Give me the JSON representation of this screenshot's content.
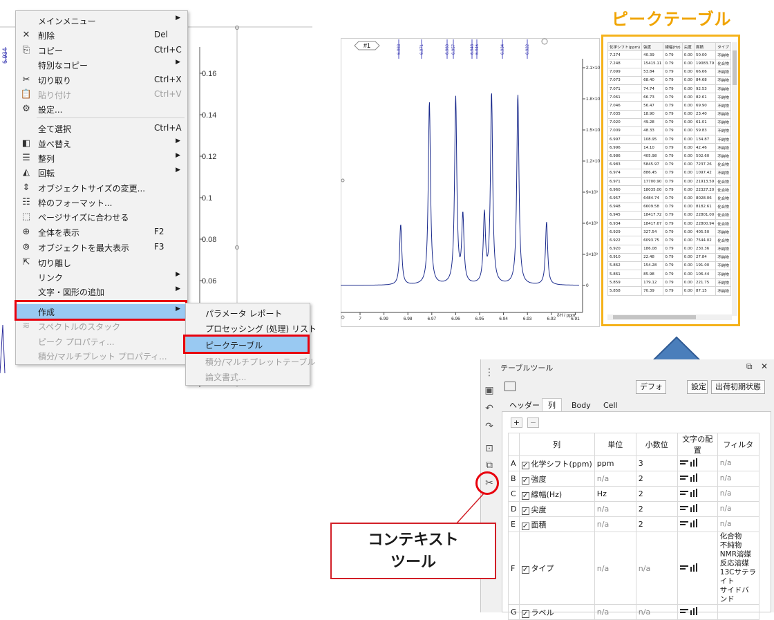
{
  "left_chart": {
    "ppm_label": "6.934",
    "y_ticks": [
      "0.16",
      "0.14",
      "0.12",
      "0.1",
      "0.08",
      "0.06"
    ]
  },
  "context_menu": {
    "items": [
      {
        "label": "メインメニュー",
        "icon": "",
        "shortcut": "",
        "arrow": true,
        "disabled": false
      },
      {
        "label": "削除",
        "icon": "close-icon",
        "shortcut": "Del",
        "arrow": false,
        "disabled": false
      },
      {
        "label": "コピー",
        "icon": "copy-icon",
        "shortcut": "Ctrl+C",
        "arrow": false,
        "disabled": false
      },
      {
        "label": "特別なコピー",
        "icon": "",
        "shortcut": "",
        "arrow": true,
        "disabled": false
      },
      {
        "label": "切り取り",
        "icon": "scissors-icon",
        "shortcut": "Ctrl+X",
        "arrow": false,
        "disabled": false
      },
      {
        "label": "貼り付け",
        "icon": "paste-icon",
        "shortcut": "Ctrl+V",
        "arrow": false,
        "disabled": true
      },
      {
        "label": "設定...",
        "icon": "gear-icon",
        "shortcut": "",
        "arrow": false,
        "disabled": false
      },
      {
        "label": "全て選択",
        "icon": "",
        "shortcut": "Ctrl+A",
        "arrow": false,
        "disabled": false
      },
      {
        "label": "並べ替え",
        "icon": "arrange-icon",
        "shortcut": "",
        "arrow": true,
        "disabled": false
      },
      {
        "label": "整列",
        "icon": "align-icon",
        "shortcut": "",
        "arrow": true,
        "disabled": false
      },
      {
        "label": "回転",
        "icon": "rotate-icon",
        "shortcut": "",
        "arrow": true,
        "disabled": false
      },
      {
        "label": "オブジェクトサイズの変更...",
        "icon": "resize-icon",
        "shortcut": "",
        "arrow": false,
        "disabled": false
      },
      {
        "label": "枠のフォーマット...",
        "icon": "format-icon",
        "shortcut": "",
        "arrow": false,
        "disabled": false
      },
      {
        "label": "ページサイズに合わせる",
        "icon": "fit-page-icon",
        "shortcut": "",
        "arrow": false,
        "disabled": false
      },
      {
        "label": "全体を表示",
        "icon": "zoom-all-icon",
        "shortcut": "F2",
        "arrow": false,
        "disabled": false
      },
      {
        "label": "オブジェクトを最大表示",
        "icon": "zoom-object-icon",
        "shortcut": "F3",
        "arrow": false,
        "disabled": false
      },
      {
        "label": "切り離し",
        "icon": "detach-icon",
        "shortcut": "",
        "arrow": false,
        "disabled": false
      },
      {
        "label": "リンク",
        "icon": "",
        "shortcut": "",
        "arrow": true,
        "disabled": false
      },
      {
        "label": "文字・図形の追加",
        "icon": "",
        "shortcut": "",
        "arrow": true,
        "disabled": false
      },
      {
        "label": "作成",
        "icon": "",
        "shortcut": "",
        "arrow": true,
        "disabled": false
      },
      {
        "label": "スペクトルのスタック",
        "icon": "stack-icon",
        "shortcut": "",
        "arrow": false,
        "disabled": true
      },
      {
        "label": "ピーク プロパティ...",
        "icon": "",
        "shortcut": "",
        "arrow": false,
        "disabled": true
      },
      {
        "label": "積分/マルチプレット プロパティ...",
        "icon": "",
        "shortcut": "",
        "arrow": false,
        "disabled": true
      }
    ]
  },
  "submenu": {
    "items": [
      {
        "label": "パラメータ レポート",
        "disabled": false
      },
      {
        "label": "プロセッシング (処理) リスト",
        "disabled": false
      },
      {
        "label": "ピークテーブル",
        "disabled": false
      },
      {
        "label": "積分/マルチプレットテーブル",
        "disabled": true
      },
      {
        "label": "論文書式...",
        "disabled": true
      }
    ]
  },
  "spectrum": {
    "badge": "#1",
    "peak_labels": [
      "6.983",
      "6.971",
      "6.960",
      "6.957",
      "6.948",
      "6.945",
      "6.934",
      "6.922"
    ],
    "x_ticks": [
      "7",
      "6.99",
      "6.98",
      "6.97",
      "6.96",
      "6.95",
      "6.94",
      "6.93",
      "6.92",
      "6.91"
    ],
    "x_unit": "δH / ppm",
    "y_ticks": [
      "2.1×10⁴",
      "1.8×10⁴",
      "1.5×10⁴",
      "1.2×10⁴",
      "9×10³",
      "6×10³",
      "3×10³",
      "0"
    ]
  },
  "peak_table": {
    "title": "ピークテーブル",
    "headers": [
      "化学シフト(ppm)",
      "強度",
      "線幅(Hz)",
      "尖度",
      "面積",
      "タイプ"
    ],
    "rows": [
      [
        "7.274",
        "40.39",
        "0.79",
        "0.00",
        "50.00",
        "不純物"
      ],
      [
        "7.248",
        "15415.11",
        "0.79",
        "0.00",
        "19083.79",
        "化合物"
      ],
      [
        "7.099",
        "53.84",
        "0.79",
        "0.00",
        "66.66",
        "不純物"
      ],
      [
        "7.073",
        "68.40",
        "0.79",
        "0.00",
        "84.68",
        "不純物"
      ],
      [
        "7.071",
        "74.74",
        "0.79",
        "0.00",
        "92.53",
        "不純物"
      ],
      [
        "7.061",
        "66.73",
        "0.79",
        "0.00",
        "82.61",
        "不純物"
      ],
      [
        "7.046",
        "56.47",
        "0.79",
        "0.00",
        "69.90",
        "不純物"
      ],
      [
        "7.035",
        "18.90",
        "0.79",
        "0.00",
        "23.40",
        "不純物"
      ],
      [
        "7.020",
        "49.28",
        "0.79",
        "0.00",
        "61.01",
        "不純物"
      ],
      [
        "7.009",
        "48.33",
        "0.79",
        "0.00",
        "59.83",
        "不純物"
      ],
      [
        "6.997",
        "108.95",
        "0.79",
        "0.00",
        "134.87",
        "不純物"
      ],
      [
        "6.996",
        "14.10",
        "0.79",
        "0.00",
        "42.46",
        "不純物"
      ],
      [
        "6.986",
        "405.98",
        "0.79",
        "0.00",
        "502.60",
        "不純物"
      ],
      [
        "6.983",
        "5845.97",
        "0.79",
        "0.00",
        "7237.26",
        "化合物"
      ],
      [
        "6.974",
        "886.45",
        "0.79",
        "0.00",
        "1097.42",
        "不純物"
      ],
      [
        "6.971",
        "17700.90",
        "0.79",
        "0.00",
        "21913.59",
        "化合物"
      ],
      [
        "6.960",
        "18035.00",
        "0.79",
        "0.00",
        "22327.20",
        "化合物"
      ],
      [
        "6.957",
        "6484.74",
        "0.79",
        "0.00",
        "8028.06",
        "化合物"
      ],
      [
        "6.948",
        "6609.58",
        "0.79",
        "0.00",
        "8182.61",
        "化合物"
      ],
      [
        "6.945",
        "18417.72",
        "0.79",
        "0.00",
        "22801.00",
        "化合物"
      ],
      [
        "6.934",
        "18417.67",
        "0.79",
        "0.00",
        "22800.94",
        "化合物"
      ],
      [
        "6.929",
        "327.54",
        "0.79",
        "0.00",
        "405.50",
        "不純物"
      ],
      [
        "6.922",
        "6093.75",
        "0.79",
        "0.00",
        "7544.02",
        "化合物"
      ],
      [
        "6.920",
        "186.08",
        "0.79",
        "0.00",
        "230.36",
        "不純物"
      ],
      [
        "6.910",
        "22.48",
        "0.79",
        "0.00",
        "27.84",
        "不純物"
      ],
      [
        "5.862",
        "154.28",
        "0.79",
        "0.00",
        "191.00",
        "不純物"
      ],
      [
        "5.861",
        "85.98",
        "0.79",
        "0.00",
        "106.44",
        "不純物"
      ],
      [
        "5.859",
        "179.12",
        "0.79",
        "0.00",
        "221.75",
        "不純物"
      ],
      [
        "5.858",
        "70.39",
        "0.79",
        "0.00",
        "87.15",
        "不純物"
      ]
    ]
  },
  "table_tool": {
    "title": "テーブルツール",
    "pin_icon": "pin-icon",
    "close_label": "✕",
    "btn_default": "デフォ",
    "btn_settings": "設定",
    "btn_factory": "出荷初期状態",
    "tabs": [
      "ヘッダー",
      "列",
      "Body",
      "Cell"
    ],
    "active_tab": "列",
    "plus": "+",
    "minus": "−",
    "col_headers": [
      "列",
      "単位",
      "小数位",
      "文字の配置",
      "フィルタ"
    ],
    "columns": [
      {
        "letter": "A",
        "name": "化学シフト(ppm)",
        "unit": "ppm",
        "decimals": "3",
        "filter": "n/a",
        "checked": true
      },
      {
        "letter": "B",
        "name": "強度",
        "unit": "n/a",
        "decimals": "2",
        "filter": "n/a",
        "checked": true
      },
      {
        "letter": "C",
        "name": "線幅(Hz)",
        "unit": "Hz",
        "decimals": "2",
        "filter": "n/a",
        "checked": true
      },
      {
        "letter": "D",
        "name": "尖度",
        "unit": "n/a",
        "decimals": "2",
        "filter": "n/a",
        "checked": true
      },
      {
        "letter": "E",
        "name": "面積",
        "unit": "n/a",
        "decimals": "2",
        "filter": "n/a",
        "checked": true
      },
      {
        "letter": "F",
        "name": "タイプ",
        "unit": "n/a",
        "decimals": "n/a",
        "filter": "化合物\n不純物\nNMR溶媒\n反応溶媒\n13Cサテライト\nサイドバンド",
        "checked": true
      },
      {
        "letter": "G",
        "name": "ラベル",
        "unit": "n/a",
        "decimals": "n/a",
        "filter": "",
        "checked": true
      }
    ]
  },
  "callout": {
    "line1": "コンテキスト",
    "line2": "ツール"
  },
  "colors": {
    "highlight_blue": "#99c9f2",
    "red_box": "#e8000d",
    "orange_frame": "#f5b21a",
    "arrow_blue": "#4a7ebb",
    "spectrum_line": "#1a2a8c"
  }
}
